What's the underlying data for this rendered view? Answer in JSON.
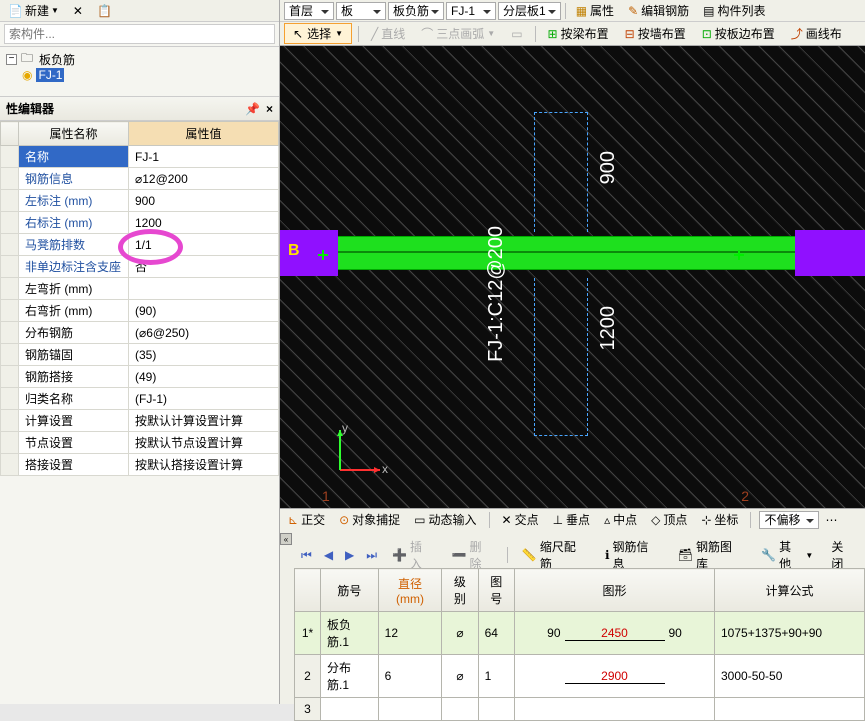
{
  "toolbar": {
    "new_label": "新建",
    "search_placeholder": "索构件..."
  },
  "tree": {
    "root": "板负筋",
    "child": "FJ-1"
  },
  "prop_editor": {
    "title": "性编辑器",
    "col_name": "属性名称",
    "col_value": "属性值",
    "rows": [
      {
        "n": "名称",
        "v": "FJ-1",
        "sel": true
      },
      {
        "n": "钢筋信息",
        "v": "⌀12@200",
        "blue": true
      },
      {
        "n": "左标注 (mm)",
        "v": "900",
        "blue": true
      },
      {
        "n": "右标注 (mm)",
        "v": "1200",
        "blue": true
      },
      {
        "n": "马凳筋排数",
        "v": "1/1",
        "blue": true
      },
      {
        "n": "非单边标注含支座",
        "v": "否",
        "blue": true
      },
      {
        "n": "左弯折 (mm)",
        "v": ""
      },
      {
        "n": "右弯折 (mm)",
        "v": "(90)"
      },
      {
        "n": "分布钢筋",
        "v": "(⌀6@250)"
      },
      {
        "n": "钢筋锚固",
        "v": "(35)"
      },
      {
        "n": "钢筋搭接",
        "v": "(49)"
      },
      {
        "n": "归类名称",
        "v": "(FJ-1)"
      },
      {
        "n": "计算设置",
        "v": "按默认计算设置计算"
      },
      {
        "n": "节点设置",
        "v": "按默认节点设置计算"
      },
      {
        "n": "搭接设置",
        "v": "按默认搭接设置计算"
      }
    ]
  },
  "top_combos": {
    "floor": "首层",
    "cat": "板",
    "sub": "板负筋",
    "item": "FJ-1",
    "layer": "分层板1"
  },
  "top_buttons": {
    "props": "属性",
    "edit_rebar": "编辑钢筋",
    "component_list": "构件列表",
    "select": "选择",
    "line": "直线",
    "arc": "三点画弧",
    "by_beam": "按梁布置",
    "by_wall": "按墙布置",
    "by_slab_edge": "按板边布置",
    "draw_line": "画线布"
  },
  "canvas": {
    "dim_top": "900",
    "dim_bottom": "1200",
    "fj_label": "FJ-1:C12@200",
    "b_label": "B",
    "axis1": "1",
    "axis2": "2"
  },
  "status": {
    "ortho": "正交",
    "osnap": "对象捕捉",
    "dyn": "动态输入",
    "intersect": "交点",
    "perp": "垂点",
    "mid": "中点",
    "apex": "顶点",
    "coord": "坐标",
    "noofs": "不偏移"
  },
  "bot_tool": {
    "insert": "插入",
    "delete": "删除",
    "scale": "缩尺配筋",
    "rebar_info": "钢筋信息",
    "rebar_lib": "钢筋图库",
    "other": "其他",
    "close": "关闭"
  },
  "bot_grid": {
    "headers": {
      "num": "筋号",
      "dia": "直径(mm)",
      "grade": "级别",
      "fig": "图号",
      "shape": "图形",
      "formula": "计算公式"
    },
    "rows": [
      {
        "idx": "1*",
        "num": "板负筋.1",
        "dia": "12",
        "grade": "⌀",
        "fig": "64",
        "s_l": "90",
        "s_mid": "2450",
        "s_r": "90",
        "formula": "1075+1375+90+90",
        "hl": true
      },
      {
        "idx": "2",
        "num": "分布筋.1",
        "dia": "6",
        "grade": "⌀",
        "fig": "1",
        "s_l": "",
        "s_mid": "2900",
        "s_r": "",
        "formula": "3000-50-50"
      },
      {
        "idx": "3",
        "num": "",
        "dia": "",
        "grade": "",
        "fig": "",
        "s_l": "",
        "s_mid": "",
        "s_r": "",
        "formula": ""
      }
    ]
  }
}
